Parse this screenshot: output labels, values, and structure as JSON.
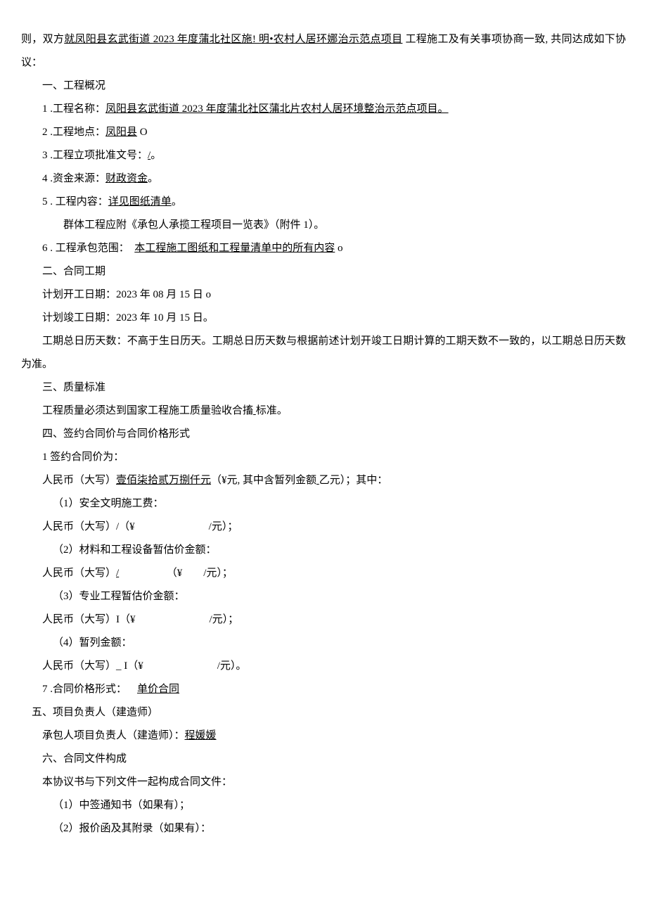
{
  "preamble": {
    "pre_text": "则，双方",
    "underlined_project": "就凤阳县玄武街道 2023 年度蒲北社区施! 明•农村人居环娜治示范点项目",
    "post_text": " 工程施工及有关事项协商一致, 共同达成如下协议："
  },
  "s1": {
    "title": "一、工程概况",
    "items": [
      {
        "label": "1 .工程名称：",
        "u": "凤阳县玄武街道 2023 年度蒲北社区蒲北片农村人居环境整治示范点项目。",
        "tail": ""
      },
      {
        "label": "2  .工程地点：",
        "u": "凤阳县",
        "tail": " O"
      },
      {
        "label": "3  .工程立项批准文号：",
        "u": "/",
        "tail": "。"
      },
      {
        "label": "4 .资金来源：",
        "u": "财政资金",
        "tail": "。"
      },
      {
        "label": "5  . 工程内容：",
        "u": "详见图纸清单",
        "tail": "。"
      }
    ],
    "group_note": "群体工程应附《承包人承揽工程项目一览表》（附件 1）。",
    "item6_label": "6  . 工程承包范围：",
    "item6_u": "本工程施工图纸和工程量清单中的所有内容",
    "item6_tail": " o"
  },
  "s2": {
    "title": "二、合同工期",
    "start": "计划开工日期：2023 年 08 月 15 日 o",
    "end": "计划竣工日期：2023 年 10 月 15 日。",
    "days": "工期总日历天数：不高于生日历天。工期总日历天数与根据前述计划开竣工日期计算的工期天数不一致的，以工期总日历天数为准。"
  },
  "s3": {
    "title": "三、质量标准",
    "text_pre": "工程质量必须达到国家工程施工质量验收合搐",
    "text_tail": "标准。"
  },
  "s4": {
    "title": "四、签约合同价与合同价格形式",
    "price_label": "1 签约合同价为：",
    "price_line_pre": "人民币（大写）",
    "price_amount": "壹佰柒拾贰万捌仟元",
    "price_line_mid": "（¥元, 其中含暂列金额",
    "price_line_tail": "乙元）；其中：",
    "sub1_label": "（1）安全文明施工费：",
    "sub1_line": "人民币（大写）/（¥　　　　　　　/元）；",
    "sub2_label": "（2）材料和工程设备暂估价金额：",
    "sub2_pre": "人民币（大写）",
    "sub2_u": "/",
    "sub2_tail": "　　　　　（¥　　/元）；",
    "sub3_label": "（3）专业工程暂估价金额：",
    "sub3_line": "人民币（大写）I（¥　　　　　　　/元）；",
    "sub4_label": "（4）暂列金额：",
    "sub4_line": "人民币（大写）_ I（¥　　　　　　　/元）。",
    "form_label": "7  .合同价格形式：",
    "form_value": "单价合同"
  },
  "s5": {
    "title": "五、项目负责人（建造师）",
    "line_pre": "承包人项目负责人（建造师）：",
    "line_name": "程媛媛"
  },
  "s6": {
    "title": "六、合同文件构成",
    "intro": "本协议书与下列文件一起构成合同文件：",
    "items": [
      "（1）中签通知书（如果有）；",
      "（2）报价函及其附录（如果有）："
    ]
  }
}
